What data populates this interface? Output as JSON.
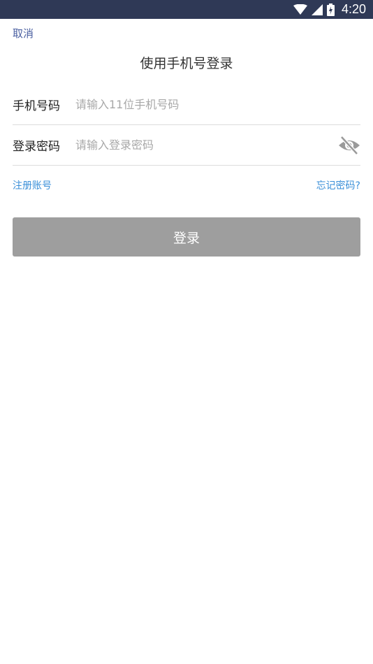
{
  "status_bar": {
    "time": "4:20",
    "icons": [
      "wifi-icon",
      "cellular-signal-icon",
      "battery-icon"
    ],
    "background_color": "#2f3956"
  },
  "header": {
    "cancel_label": "取消",
    "title": "使用手机号登录"
  },
  "form": {
    "phone": {
      "label": "手机号码",
      "placeholder": "请输入11位手机号码",
      "value": ""
    },
    "password": {
      "label": "登录密码",
      "placeholder": "请输入登录密码",
      "value": "",
      "toggle_icon": "eye-off-icon"
    }
  },
  "links": {
    "register_label": "注册账号",
    "forgot_label": "忘记密码?"
  },
  "login_button": {
    "label": "登录",
    "color": "#9e9e9e"
  },
  "colors": {
    "link": "#3a8fd8",
    "cancel": "#4a5fa0"
  }
}
